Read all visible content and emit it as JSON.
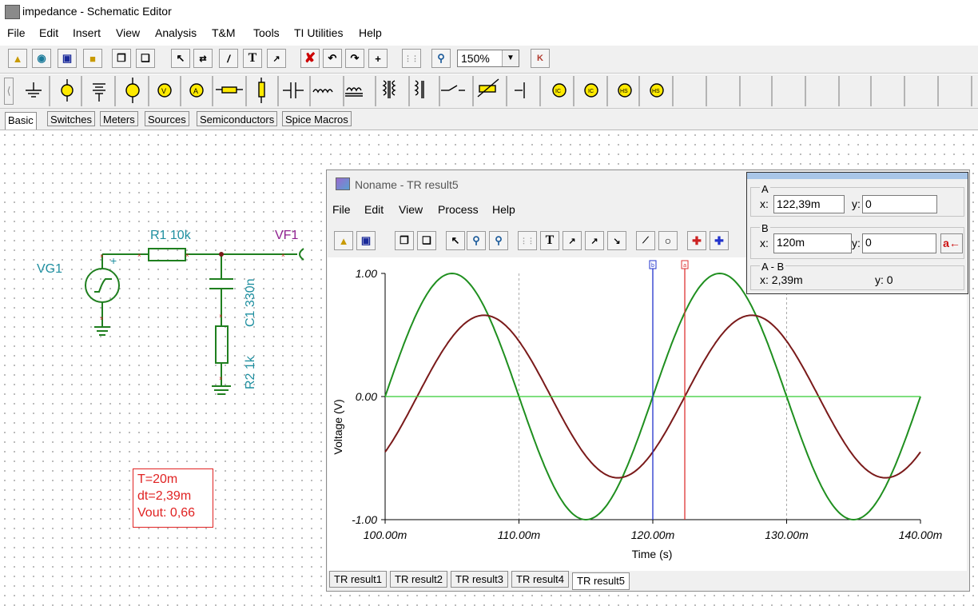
{
  "window": {
    "title": "impedance - Schematic Editor"
  },
  "menu": [
    "File",
    "Edit",
    "Insert",
    "View",
    "Analysis",
    "T&M",
    "Tools",
    "TI Utilities",
    "Help"
  ],
  "toolbar": {
    "zoom_value": "150%"
  },
  "component_tabs": [
    "Basic",
    "Switches",
    "Meters",
    "Sources",
    "Semiconductors",
    "Spice Macros"
  ],
  "schematic": {
    "vg1": "VG1",
    "r1": "R1 10k",
    "vf1": "VF1",
    "c1": "C1 330n",
    "r2": "R2 1k",
    "plus": "+",
    "annotation": {
      "line1": "T=20m",
      "line2": "dt=2,39m",
      "line3": "Vout: 0,66"
    }
  },
  "result_window": {
    "title": "Noname - TR result5",
    "menu": [
      "File",
      "Edit",
      "View",
      "Process",
      "Help"
    ],
    "tabs": [
      "TR result1",
      "TR result2",
      "TR result3",
      "TR result4",
      "TR result5"
    ],
    "active_tab": "TR result5"
  },
  "cursor_panel": {
    "a": {
      "label": "A",
      "x_label": "x:",
      "x_value": "122,39m",
      "y_label": "y:",
      "y_value": "0"
    },
    "b": {
      "label": "B",
      "x_label": "x:",
      "x_value": "120m",
      "y_label": "y:",
      "y_value": "0"
    },
    "diff": {
      "label": "A - B",
      "x_text": "x:  2,39m",
      "y_text": "y: 0"
    },
    "button": "a←"
  },
  "chart_data": {
    "type": "line",
    "xlabel": "Time (s)",
    "ylabel": "Voltage (V)",
    "xlim": [
      0.1,
      0.14
    ],
    "ylim": [
      -1.0,
      1.0
    ],
    "x_ticks": [
      "100.00m",
      "110.00m",
      "120.00m",
      "130.00m",
      "140.00m"
    ],
    "y_ticks": [
      "1.00",
      "0.00",
      "-1.00"
    ],
    "grid": true,
    "series": [
      {
        "color": "#1f8f1f",
        "amplitude": 1.0,
        "period": 0.02,
        "zero_cross_rising": 0.12,
        "x": [
          0.1,
          0.105,
          0.11,
          0.115,
          0.12,
          0.125,
          0.13,
          0.135,
          0.14
        ],
        "y": [
          0.0,
          1.0,
          0.0,
          -1.0,
          0.0,
          1.0,
          0.0,
          -1.0,
          0.0
        ]
      },
      {
        "color": "#7a1a1a",
        "amplitude": 0.66,
        "period": 0.02,
        "zero_cross_rising": 0.12239,
        "x": [
          0.1,
          0.1074,
          0.1124,
          0.1174,
          0.1224,
          0.1274,
          0.1324,
          0.1374,
          0.14
        ],
        "y": [
          -0.45,
          0.66,
          0.0,
          -0.66,
          0.0,
          0.66,
          0.0,
          -0.66,
          -0.45
        ]
      },
      {
        "color": "#33cc33",
        "x": [
          0.1,
          0.14
        ],
        "y": [
          0.0,
          0.0
        ]
      }
    ],
    "cursors": [
      {
        "name": "b",
        "x": 0.12,
        "color": "#2233cc"
      },
      {
        "name": "a",
        "x": 0.12239,
        "color": "#dd3333"
      }
    ]
  }
}
